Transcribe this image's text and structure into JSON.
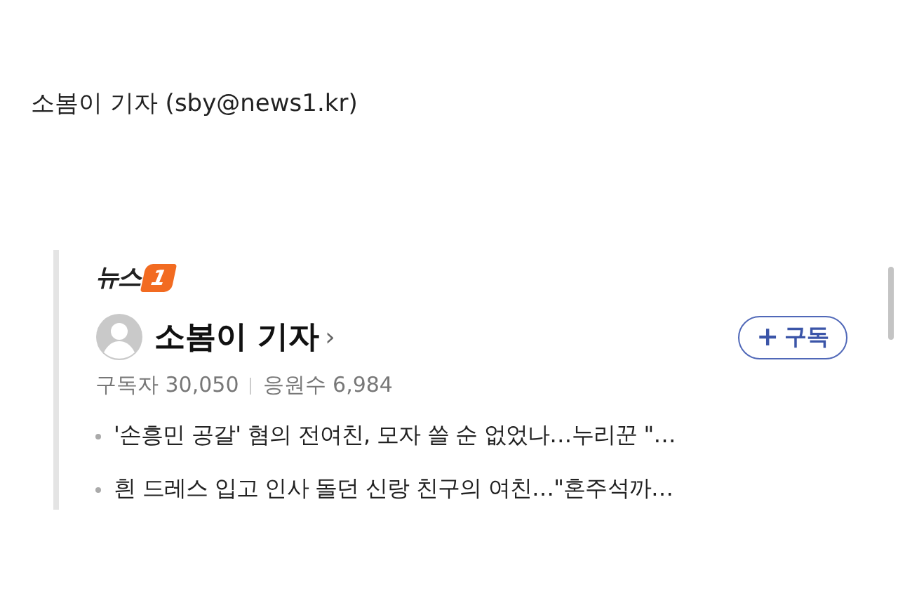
{
  "byline": "소봄이 기자 (sby@news1.kr)",
  "card": {
    "logo": {
      "text": "뉴스",
      "mark": "1"
    },
    "reporter": {
      "name": "소봄이 기자",
      "chevron": "›"
    },
    "subscribe_button": {
      "icon": "+",
      "label": "구독"
    },
    "stats": [
      {
        "label": "구독자",
        "value": "30,050"
      },
      {
        "label": "응원수",
        "value": "6,984"
      }
    ],
    "articles": [
      "'손흥민 공갈' 혐의 전여친, 모자 쓸 순 없었나…누리꾼 \"…",
      "흰 드레스 입고 인사 돌던 신랑 친구의 여친…\"혼주석까…"
    ]
  }
}
